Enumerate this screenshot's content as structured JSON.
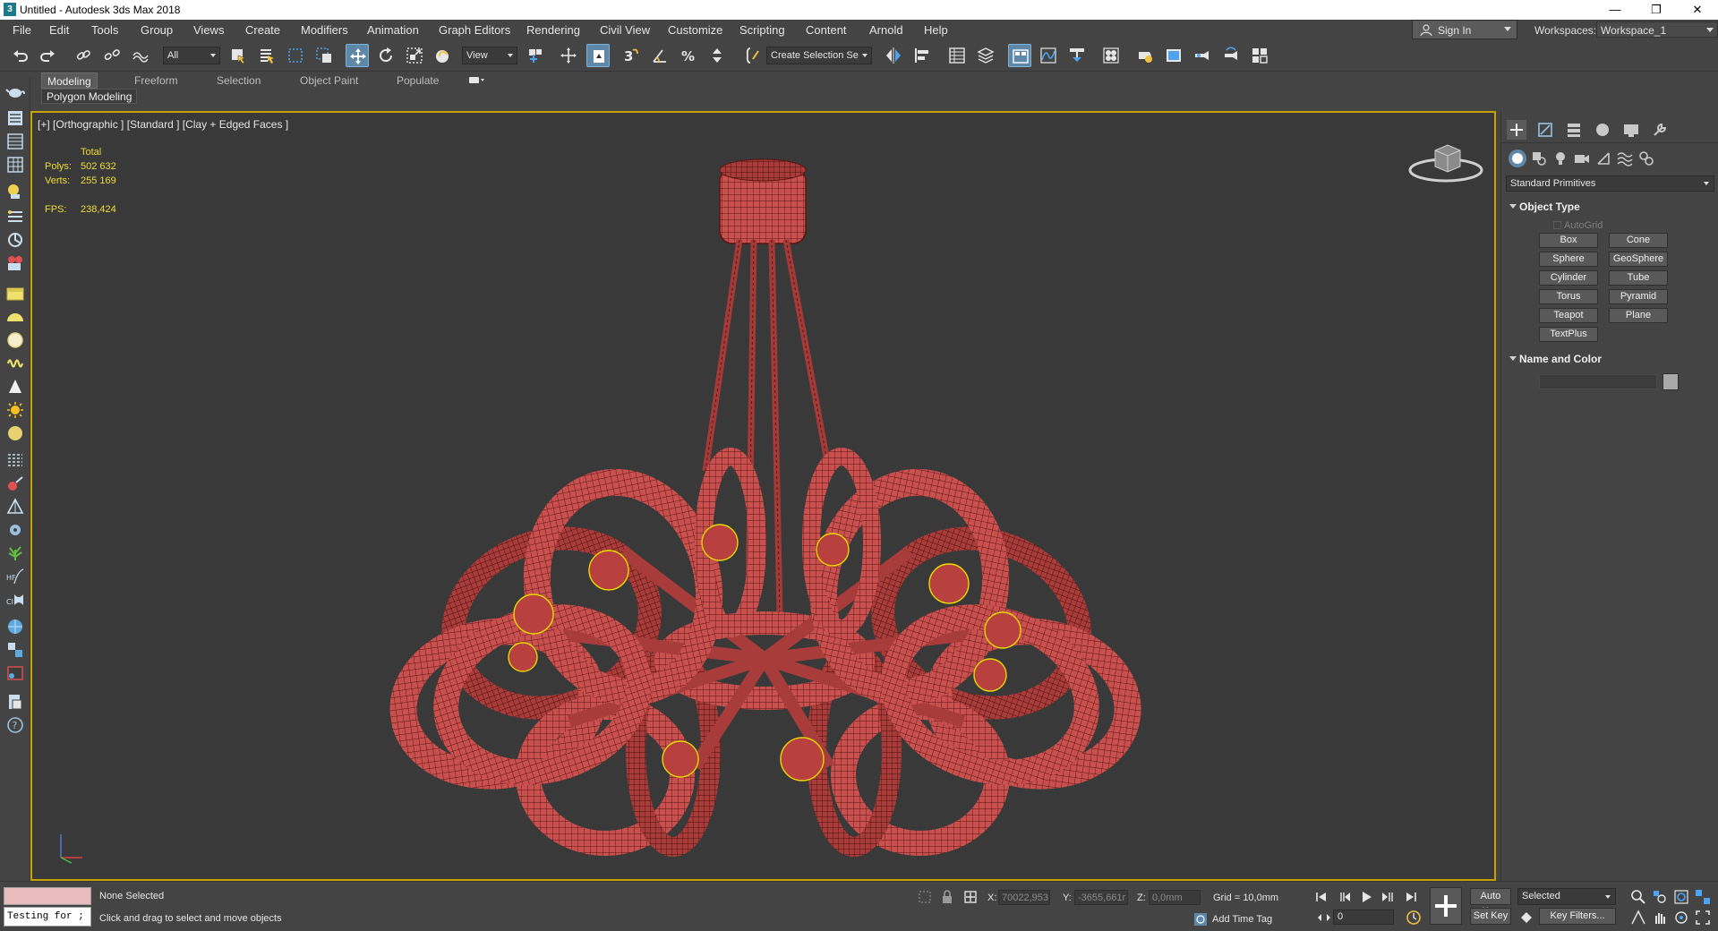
{
  "window": {
    "title": "Untitled - Autodesk 3ds Max 2018",
    "app_icon": "3",
    "controls": [
      "minimize-icon",
      "restore-icon",
      "close-icon"
    ]
  },
  "menu": {
    "items": [
      "File",
      "Edit",
      "Tools",
      "Group",
      "Views",
      "Create",
      "Modifiers",
      "Animation",
      "Graph Editors",
      "Rendering",
      "Civil View",
      "Customize",
      "Scripting",
      "Content",
      "Arnold",
      "Help"
    ],
    "sign_in": "Sign In",
    "workspaces_label": "Workspaces:",
    "workspace_value": "Workspace_1"
  },
  "toolbar": {
    "selection_filter": "All",
    "ref_coord": "View",
    "named_selection": "Create Selection Se",
    "icons": [
      "undo-icon",
      "redo-icon",
      "link-icon",
      "unlink-icon",
      "bind-spacewarp-icon",
      "select-object-icon",
      "select-by-name-icon",
      "rect-selection-icon",
      "window-crossing-icon",
      "select-move-icon",
      "select-rotate-icon",
      "select-scale-icon",
      "select-place-icon",
      "pivot-icon",
      "keyboard-shortcut-icon",
      "snap-3d-icon",
      "angle-snap-icon",
      "percent-snap-icon",
      "spinner-snap-icon",
      "edit-named-sel-icon",
      "mirror-icon",
      "align-icon",
      "scene-explorer-icon",
      "layer-explorer-icon",
      "ribbon-toggle-icon",
      "curve-editor-icon",
      "schematic-view-icon",
      "material-editor-icon",
      "render-setup-icon",
      "rendered-frame-icon",
      "render-icon",
      "render-iterative-icon",
      "a360-render-icon"
    ]
  },
  "ribbon": {
    "tabs": [
      "Modeling",
      "Freeform",
      "Selection",
      "Object Paint",
      "Populate"
    ],
    "active_tab": "Modeling",
    "panel_label": "Polygon Modeling"
  },
  "viewport": {
    "label": "[+] [Orthographic ] [Standard ] [Clay + Edged Faces ]",
    "stats": {
      "header": "Total",
      "polys_label": "Polys:",
      "polys_value": "502 632",
      "verts_label": "Verts:",
      "verts_value": "255 169",
      "fps_label": "FPS:",
      "fps_value": "238,424"
    },
    "model_color": "#c8504e",
    "wire_color": "#5a1410",
    "bulb_outline_color": "#e8d800",
    "border_color": "#c8a300"
  },
  "command_panel": {
    "category": "Standard Primitives",
    "object_type": {
      "title": "Object Type",
      "autogrid": "AutoGrid",
      "buttons": [
        "Box",
        "Cone",
        "Sphere",
        "GeoSphere",
        "Cylinder",
        "Tube",
        "Torus",
        "Pyramid",
        "Teapot",
        "Plane",
        "TextPlus"
      ]
    },
    "name_and_color": {
      "title": "Name and Color",
      "name_value": ""
    }
  },
  "status": {
    "script_input": "Testing for ;",
    "selection_status": "None Selected",
    "prompt": "Click and drag to select and move objects",
    "x_label": "X:",
    "x_value": "70022,953",
    "y_label": "Y:",
    "y_value": "-3655,661r",
    "z_label": "Z:",
    "z_value": "0,0mm",
    "grid": "Grid = 10,0mm",
    "add_time_tag": "Add Time Tag",
    "auto_key": "Auto Key",
    "set_key": "Set Key",
    "key_mode": "Selected",
    "key_filters": "Key Filters...",
    "frame": "0"
  }
}
